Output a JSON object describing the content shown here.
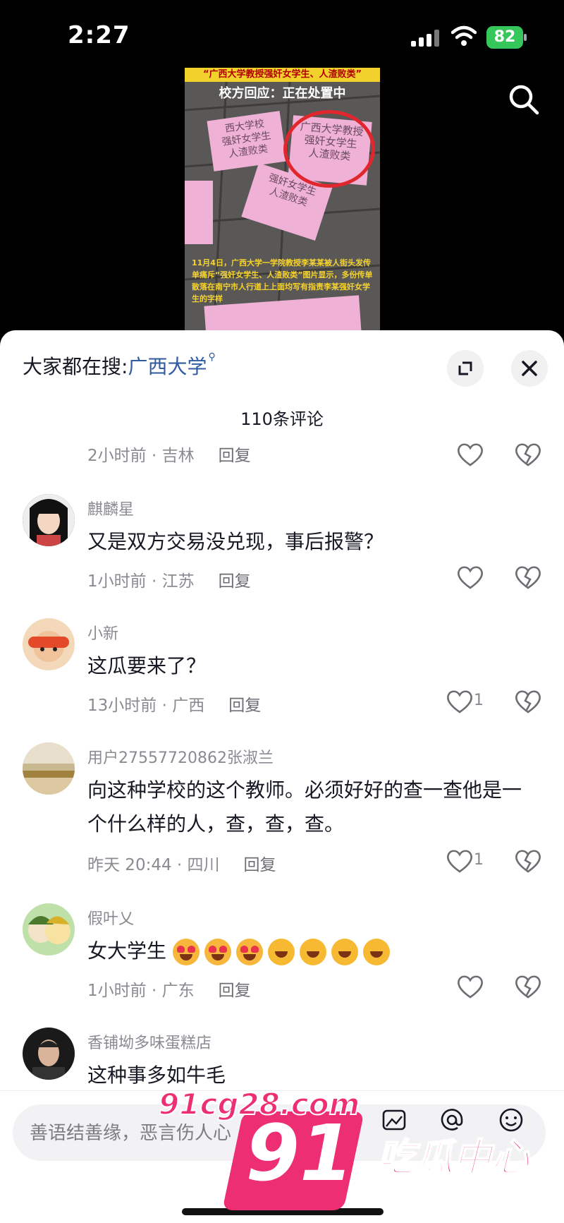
{
  "status_bar": {
    "time": "2:27",
    "battery": "82"
  },
  "video": {
    "banner": "“广西大学教授强奸女学生、人渣败类”",
    "heading": "校方回应：正在处置中",
    "papers": [
      "西大学校\n强奸女学生\n人渣败类",
      "广西大学教授\n强奸女学生\n人渣败类",
      "强奸女学生\n人渣败类"
    ],
    "caption": "11月4日，广西大学一学院教授李某某被人街头发传单痛斥“强奸女学生、人渣败类”图片显示，多份传单散落在南宁市人行道上上面均写有指责李某强奸女学生的字样"
  },
  "panel": {
    "trending_prefix": "大家都在搜:",
    "trending_keyword": "广西大学",
    "comment_count": "110条评论"
  },
  "comments_partial": {
    "time": "2小时前",
    "location": "吉林",
    "reply": "回复"
  },
  "comments": [
    {
      "user": "麒麟星",
      "text": "又是双方交易没兑现，事后报警？",
      "time": "1小时前",
      "location": "江苏",
      "reply": "回复",
      "likes": ""
    },
    {
      "user": "小新",
      "text": "这瓜要来了？",
      "time": "13小时前",
      "location": "广西",
      "reply": "回复",
      "likes": "1"
    },
    {
      "user": "用户27557720862张淑兰",
      "text": "向这种学校的这个教师。必须好好的查一查他是一个什么样的人，查，查，查。",
      "time": "昨天 20:44",
      "location": "四川",
      "reply": "回复",
      "likes": "1"
    },
    {
      "user": "假叶乂",
      "text": "女大学生",
      "time": "1小时前",
      "location": "广东",
      "reply": "回复",
      "likes": ""
    },
    {
      "user": "香铺坳多味蛋糕店",
      "text": "这种事多如牛毛"
    }
  ],
  "input": {
    "placeholder": "善语结善缘，恶言伤人心"
  },
  "watermark": {
    "number": "91",
    "domain": "91cg28.com",
    "slogan": "吃瓜中心"
  },
  "colors": {
    "accent_link": "#2f5ba0",
    "watermark": "#ee2e72"
  }
}
